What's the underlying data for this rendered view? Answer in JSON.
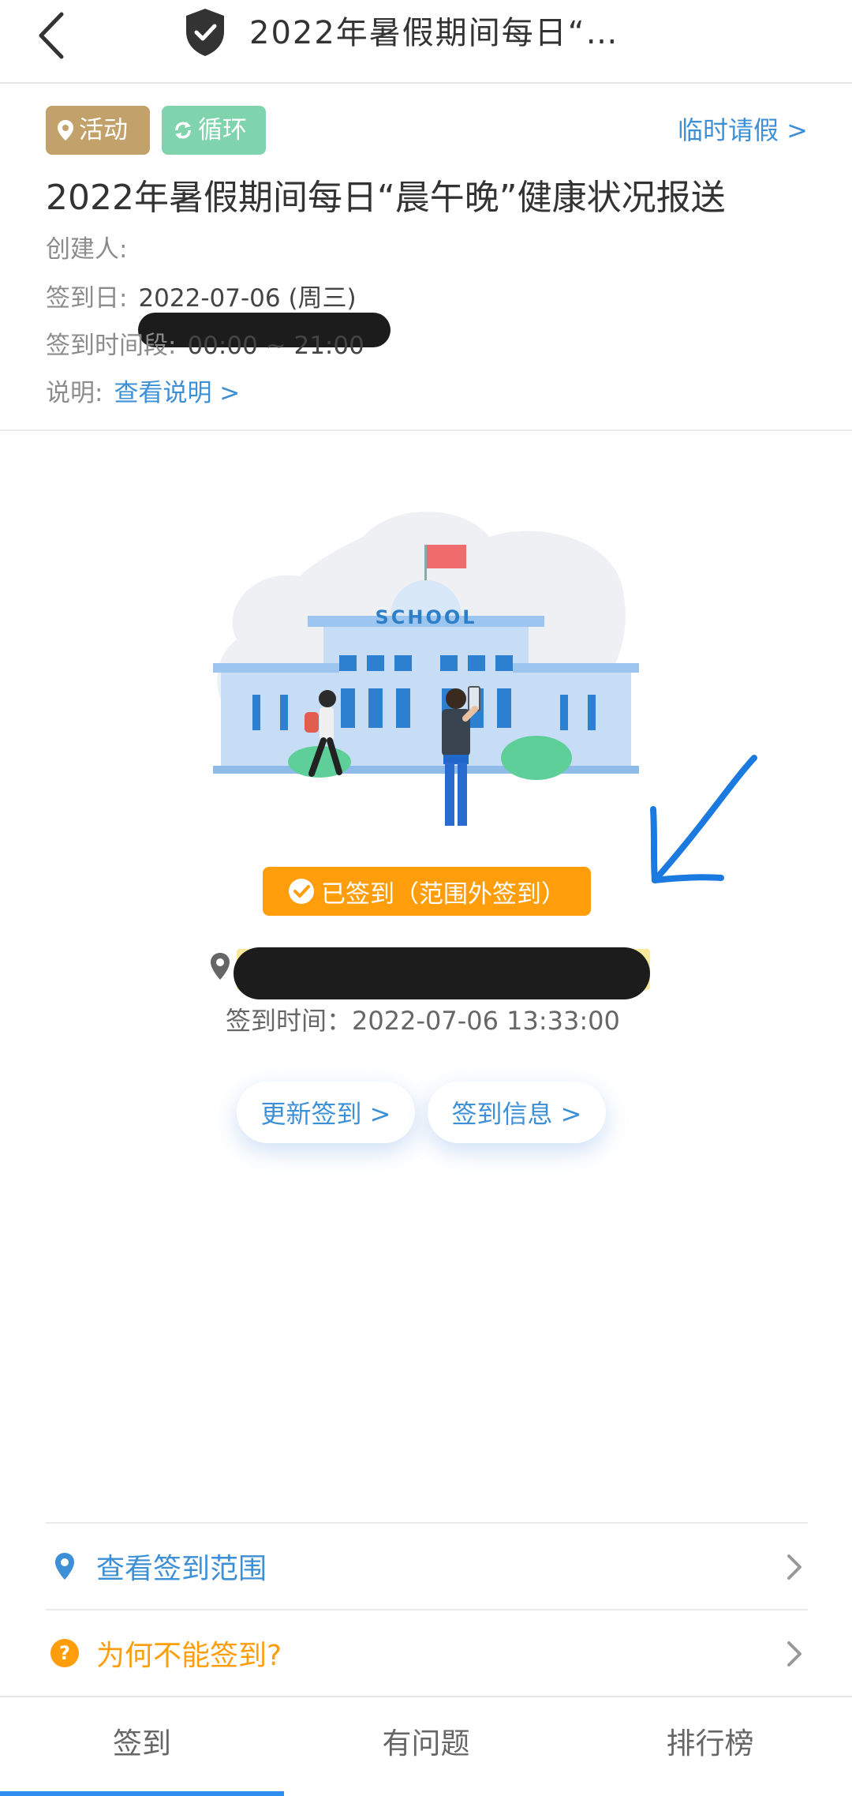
{
  "navbar": {
    "title": "2022年暑假期间每日“…"
  },
  "info": {
    "tag_activity": "活动",
    "tag_cycle": "循环",
    "leave_link": "临时请假 >",
    "title": "2022年暑假期间每日“晨午晚”健康状况报送",
    "creator_label": "创建人:",
    "signin_date_label": "签到日:",
    "signin_date_value": "2022-07-06 (周三)",
    "signin_period_label": "签到时间段:",
    "signin_period_value": "00:00 ~ 21:00",
    "desc_label": "说明:",
    "desc_link": "查看说明 >"
  },
  "illustration": {
    "sign_text": "SCHOOL"
  },
  "status": {
    "badge": "已签到（范围外签到）",
    "signin_time": "签到时间：2022-07-06 13:33:00"
  },
  "actions": {
    "update_label": "更新签到 >",
    "info_label": "签到信息 >"
  },
  "list": {
    "range_label": "查看签到范围",
    "why_label": "为何不能签到?"
  },
  "tabs": [
    "签到",
    "有问题",
    "排行榜"
  ],
  "colors": {
    "accent_blue": "#3d8fd6",
    "status_orange": "#ff9d0a",
    "tag_gold": "#c2a26a",
    "tag_green": "#7fd3ad"
  }
}
